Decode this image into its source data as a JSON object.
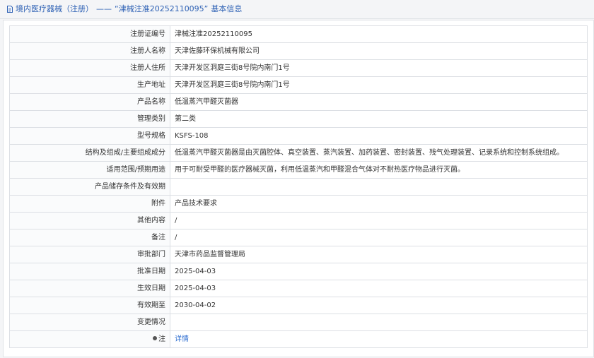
{
  "header": {
    "breadcrumb": "境内医疗器械（注册）",
    "separator": "——",
    "record_title": "“津械注准20252110095”",
    "suffix": "基本信息"
  },
  "rows": [
    {
      "label": "注册证编号",
      "value": "津械注准20252110095"
    },
    {
      "label": "注册人名称",
      "value": "天津佐藤环保机械有限公司"
    },
    {
      "label": "注册人住所",
      "value": "天津开发区洞庭三街8号院内南门1号"
    },
    {
      "label": "生产地址",
      "value": "天津开发区洞庭三街8号院内南门1号"
    },
    {
      "label": "产品名称",
      "value": "低温蒸汽甲醛灭菌器"
    },
    {
      "label": "管理类别",
      "value": "第二类"
    },
    {
      "label": "型号规格",
      "value": "KSFS-108"
    },
    {
      "label": "结构及组成/主要组成成分",
      "value": "低温蒸汽甲醛灭菌器是由灭菌腔体、真空装置、蒸汽装置、加药装置、密封装置、残气处理装置、记录系统和控制系统组成。"
    },
    {
      "label": "适用范围/预期用途",
      "value": "用于可耐受甲醛的医疗器械灭菌，利用低温蒸汽和甲醛混合气体对不耐热医疗物品进行灭菌。"
    },
    {
      "label": "产品储存条件及有效期",
      "value": ""
    },
    {
      "label": "附件",
      "value": "产品技术要求"
    },
    {
      "label": "其他内容",
      "value": "/"
    },
    {
      "label": "备注",
      "value": "/"
    },
    {
      "label": "审批部门",
      "value": "天津市药品监督管理局"
    },
    {
      "label": "批准日期",
      "value": "2025-04-03"
    },
    {
      "label": "生效日期",
      "value": "2025-04-03"
    },
    {
      "label": "有效期至",
      "value": "2030-04-02"
    },
    {
      "label": "变更情况",
      "value": ""
    },
    {
      "label": "注",
      "value": "详情"
    }
  ],
  "icons": {
    "header_icon": "document-icon",
    "note_icon": "dot-icon"
  },
  "colors": {
    "link": "#2f6fd1",
    "title": "#2f62b5",
    "border": "#dcdfe4"
  }
}
